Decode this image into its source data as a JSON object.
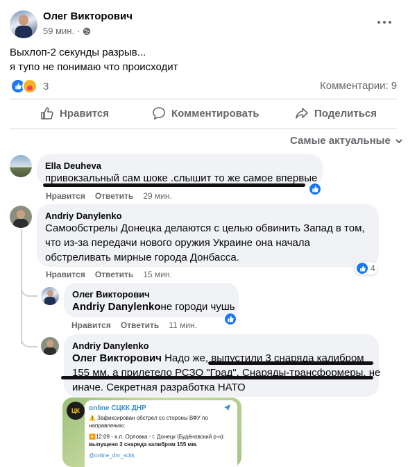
{
  "post": {
    "author": "Олег Викторович",
    "time": "59 мин.",
    "text_line1": "Выхлоп-2 секунды разрыв...",
    "text_line2": "я тупо не понимаю что происходит",
    "reaction_count": "3",
    "comments_count": "Комментарии: 9"
  },
  "actions": {
    "like": "Нравится",
    "comment": "Комментировать",
    "share": "Поделиться"
  },
  "sort_label": "Самые актуальные",
  "comments": [
    {
      "author": "Ella Deuheva",
      "text": "привокзальный сам шоке .слышит то же самое впервые",
      "like": "Нравится",
      "reply": "Ответить",
      "time": "29 мин."
    },
    {
      "author": "Andriy Danylenko",
      "text_line1": "Самообстрелы Донецка делаются с целью обвинить Запад в том,",
      "text_line2": "что из-за передачи нового оружия Украине она начала",
      "text_line3": "обстреливать мирные города Донбасса.",
      "like": "Нравится",
      "reply": "Ответить",
      "time": "15 мин.",
      "reaction_count": "4"
    }
  ],
  "replies": [
    {
      "author": "Олег Викторович",
      "mention": "Andriy Danylenko",
      "text": "не городи чушь",
      "like": "Нравится",
      "reply": "Ответить",
      "time": "11 мин."
    },
    {
      "author": "Andriy Danylenko",
      "mention": "Олег Викторович",
      "text_line1": " Надо же, выпустили 3 снаряда калибром",
      "text_line2": "155 мм, а прилетело РСЗО \"Град\". Снаряды-трансформеры, не",
      "text_line3": "иначе. Секретная разработка НАТО"
    }
  ],
  "attachment": {
    "channel": "online СЦКК ДНР",
    "line1": "⚠️ Зафиксирован обстрел со стороны ВФУ по",
    "line2": "направлению:",
    "line3": "▶️12:09 - н.п. Орловка - г. Донецк (Будёновский р-н):",
    "line4": "выпущено 3 снаряда калибром 155 мм.",
    "link": "@online_dnr_sckk",
    "badge": "ЦК"
  },
  "colors": {
    "accent": "#1877f2",
    "secondary_text": "#65676b",
    "bubble": "#f0f2f5"
  }
}
